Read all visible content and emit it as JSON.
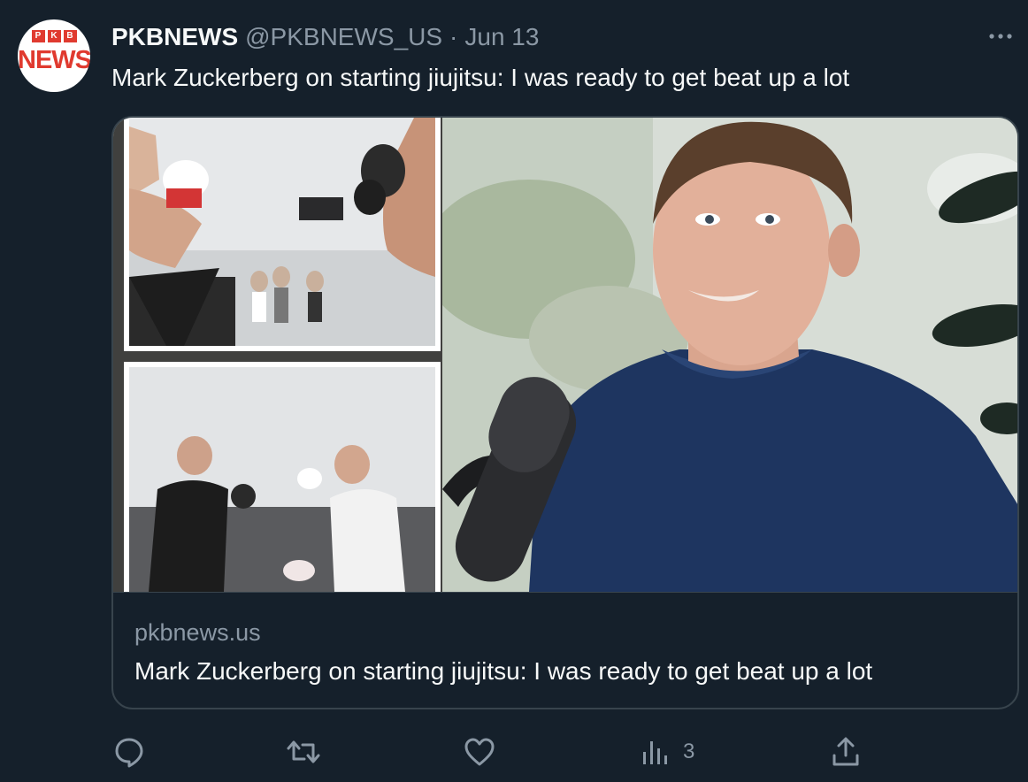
{
  "account": {
    "avatar_text_top": [
      "P",
      "K",
      "B"
    ],
    "avatar_text_bottom": "NEWS",
    "name": "PKBNEWS",
    "handle": "@PKBNEWS_US",
    "separator": "·",
    "date": "Jun 13"
  },
  "tweet": {
    "text": "Mark Zuckerberg on starting jiujitsu: I was ready to get beat up a lot",
    "more_icon": "more-horizontal-icon"
  },
  "card": {
    "domain": "pkbnews.us",
    "title": "Mark Zuckerberg on starting jiujitsu: I was ready to get beat up a lot"
  },
  "actions": {
    "reply_icon": "reply-icon",
    "retweet_icon": "retweet-icon",
    "like_icon": "heart-icon",
    "views_icon": "views-icon",
    "views_count": "3",
    "share_icon": "share-icon"
  },
  "colors": {
    "background": "#15202b",
    "text_primary": "#f7f9f9",
    "text_secondary": "#8b98a5",
    "border": "#38444d",
    "brand_red": "#e03a2f"
  }
}
